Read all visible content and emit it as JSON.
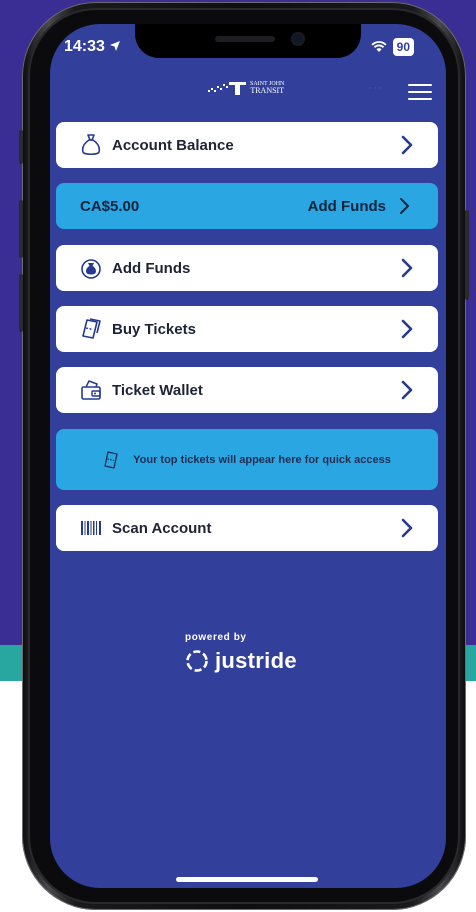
{
  "status_bar": {
    "time": "14:33",
    "battery": "90"
  },
  "header": {
    "logo_line1": "SAINT JOHN",
    "logo_line2": "TRANSIT",
    "menu_dots": "···"
  },
  "menu": {
    "account_balance": "Account Balance",
    "balance_amount": "CA$5.00",
    "balance_add_funds": "Add Funds",
    "add_funds": "Add Funds",
    "buy_tickets": "Buy Tickets",
    "ticket_wallet": "Ticket Wallet",
    "top_tickets_message": "Your top tickets will appear here for quick access",
    "scan_account": "Scan Account"
  },
  "footer": {
    "powered_by": "powered by",
    "brand": "justride"
  },
  "colors": {
    "background": "#3a2e94",
    "screen": "#32409b",
    "accent_blue": "#2aa6e3",
    "teal_band": "#27a7a0",
    "card": "#ffffff",
    "chevron": "#253a8f"
  },
  "icons": {
    "account_balance": "money-bag-icon",
    "add_funds": "coin-bag-icon",
    "buy_tickets": "tickets-icon",
    "ticket_wallet": "wallet-icon",
    "scan_account": "barcode-icon",
    "info": "ticket-outline-icon",
    "menu": "hamburger-icon"
  }
}
